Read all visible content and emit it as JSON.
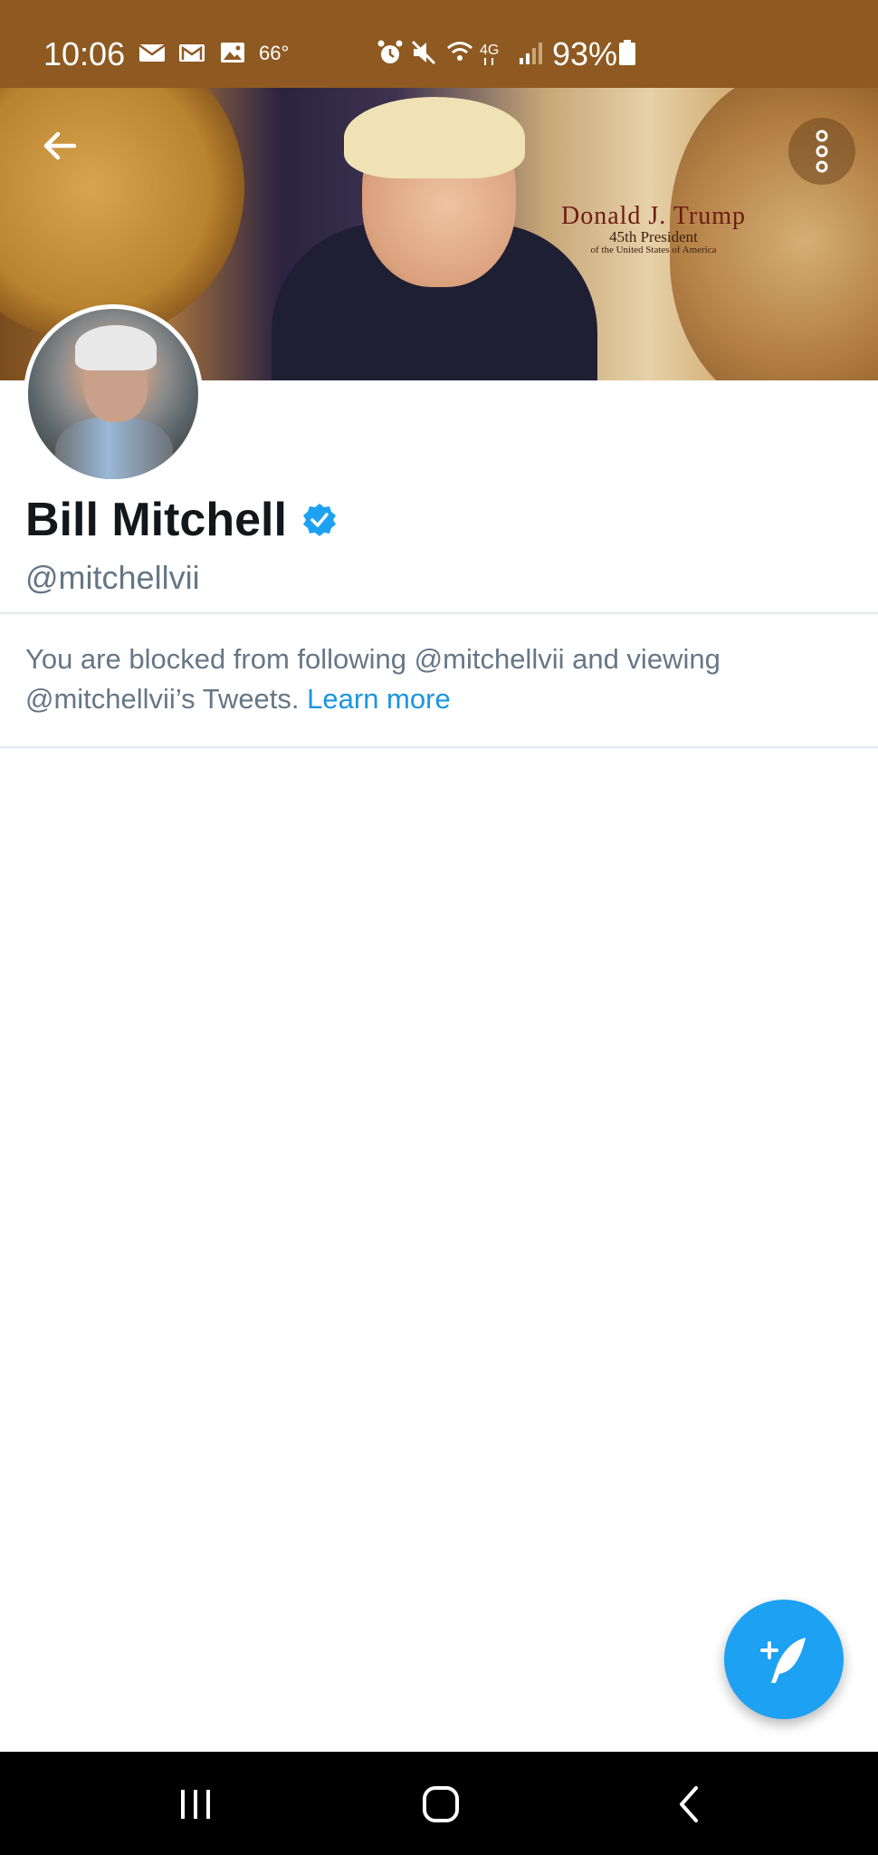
{
  "status_bar": {
    "time": "10:06",
    "temperature": "66°",
    "network": "4G",
    "battery": "93%",
    "background": "#8e5a22"
  },
  "banner": {
    "title_line1": "Donald J. Trump",
    "title_line2": "45th President",
    "title_line3": "of the United States of America"
  },
  "profile": {
    "display_name": "Bill Mitchell",
    "handle": "@mitchellvii",
    "verified": true
  },
  "blocked_notice": {
    "message": "You are blocked from following @mitchellvii and viewing @mitchellvii’s Tweets.",
    "link_text": "Learn more"
  },
  "fab": {
    "icon": "compose-tweet-icon",
    "color": "#1da1f2"
  },
  "nav": {
    "recents": "recents-icon",
    "home": "home-icon",
    "back": "back-icon"
  },
  "colors": {
    "accent": "#1da1f2",
    "link": "#1b95e0",
    "secondary_text": "#657786"
  }
}
